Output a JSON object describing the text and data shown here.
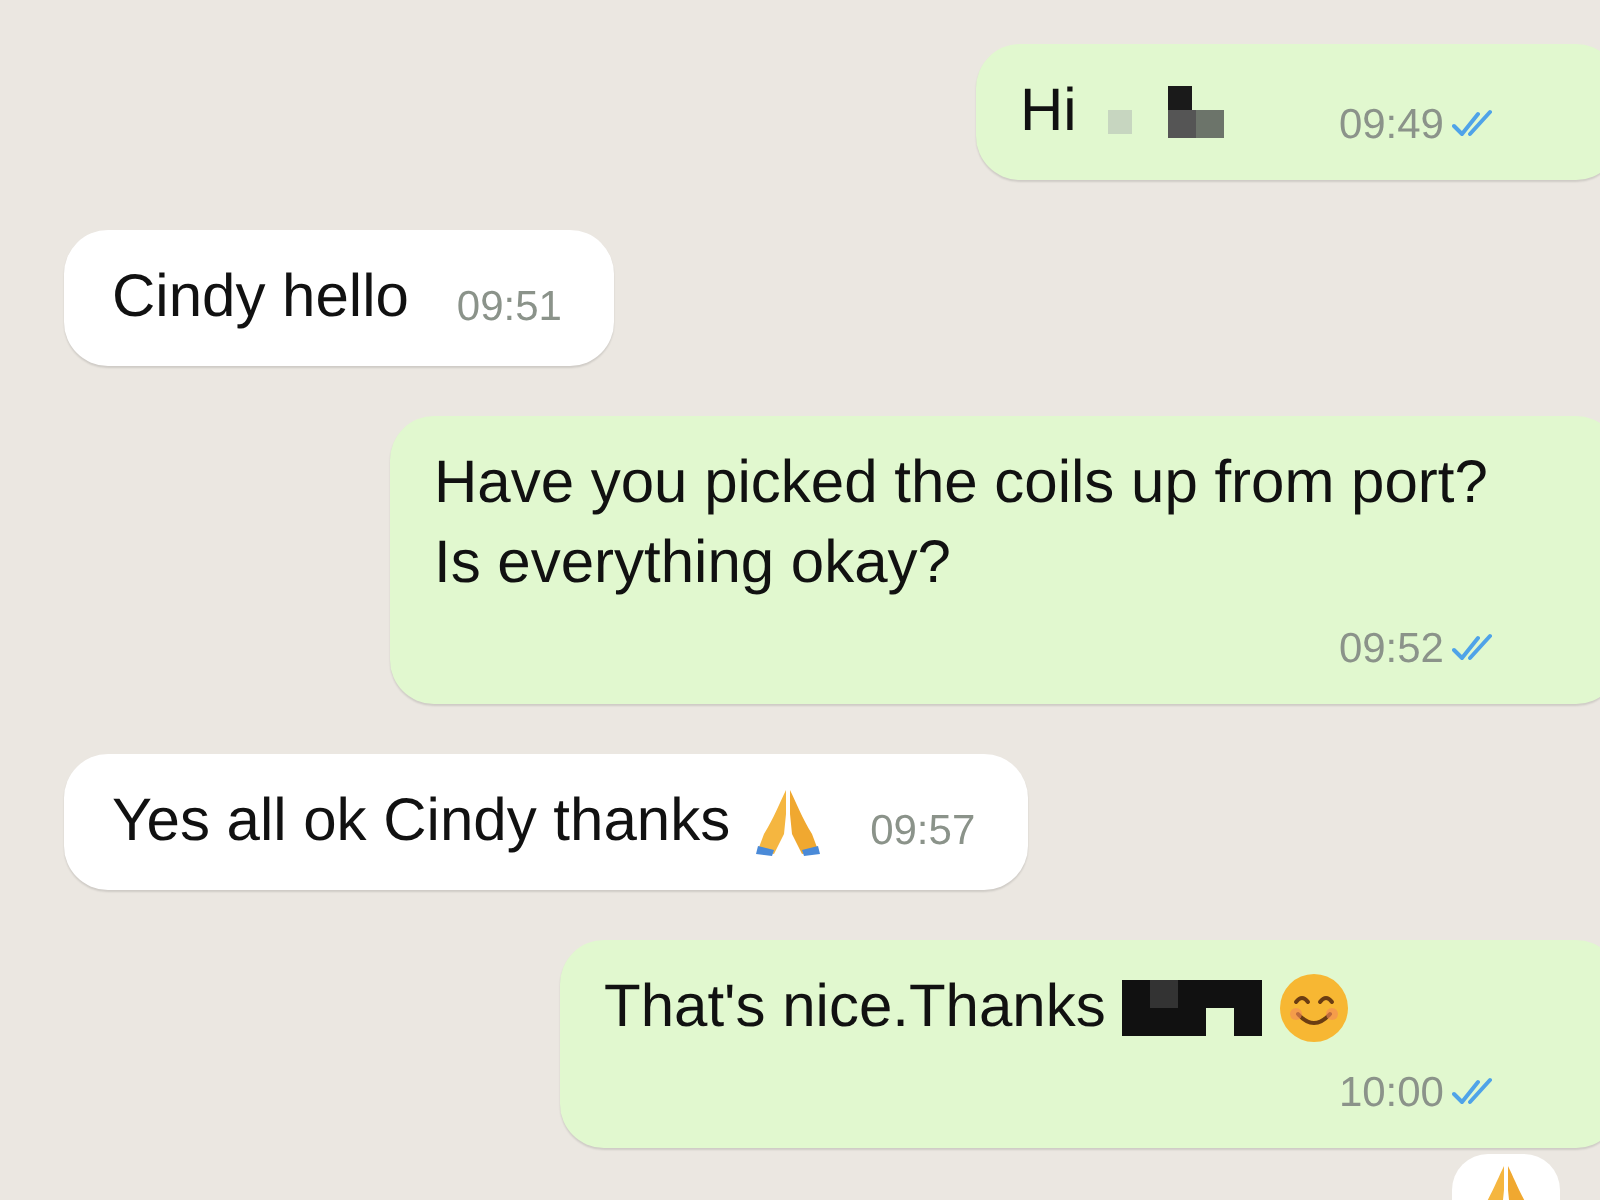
{
  "messages": [
    {
      "kind": "outgoing",
      "parts": [
        {
          "kind": "text",
          "text": "Hi"
        },
        {
          "kind": "redaction"
        }
      ],
      "time": "09:49",
      "read": true
    },
    {
      "kind": "incoming",
      "parts": [
        {
          "kind": "text",
          "text": "Cindy hello"
        }
      ],
      "time": "09:51"
    },
    {
      "kind": "outgoing",
      "parts": [
        {
          "kind": "text",
          "text": "Have you picked the coils up from port? Is everything okay?"
        }
      ],
      "time": "09:52",
      "read": true
    },
    {
      "kind": "incoming",
      "parts": [
        {
          "kind": "text",
          "text": "Yes all ok Cindy thanks"
        },
        {
          "kind": "pray"
        }
      ],
      "time": "09:57"
    },
    {
      "kind": "outgoing",
      "parts": [
        {
          "kind": "text",
          "text": "That's nice.Thanks"
        },
        {
          "kind": "redaction"
        },
        {
          "kind": "smile"
        }
      ],
      "time": "10:00",
      "read": true
    },
    {
      "kind": "reaction",
      "parts": [
        {
          "kind": "pray"
        }
      ]
    }
  ]
}
